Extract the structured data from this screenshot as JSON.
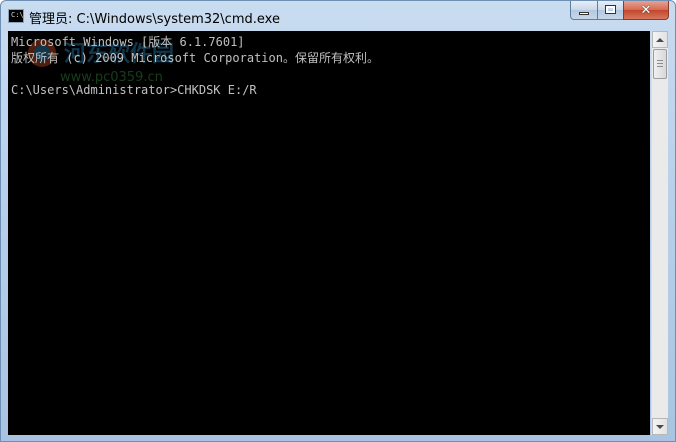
{
  "window": {
    "title": "管理员: C:\\Windows\\system32\\cmd.exe",
    "icon": "cmd-icon",
    "icon_text": "C:\\"
  },
  "caption_buttons": {
    "minimize_icon": "minimize-icon",
    "maximize_icon": "maximize-icon",
    "close_icon": "close-icon",
    "close_glyph": "✕"
  },
  "console": {
    "lines": [
      "Microsoft Windows [版本 6.1.7601]",
      "版权所有 (c) 2009 Microsoft Corporation。保留所有权利。",
      "",
      "C:\\Users\\Administrator>CHKDSK E:/R"
    ],
    "text_color": "#c0c0c0",
    "background_color": "#000000"
  },
  "watermark": {
    "text": "河东软件园",
    "url_text": "www.pc0359.cn"
  },
  "scrollbar": {
    "up_icon": "scroll-up-arrow-icon",
    "down_icon": "scroll-down-arrow-icon"
  }
}
